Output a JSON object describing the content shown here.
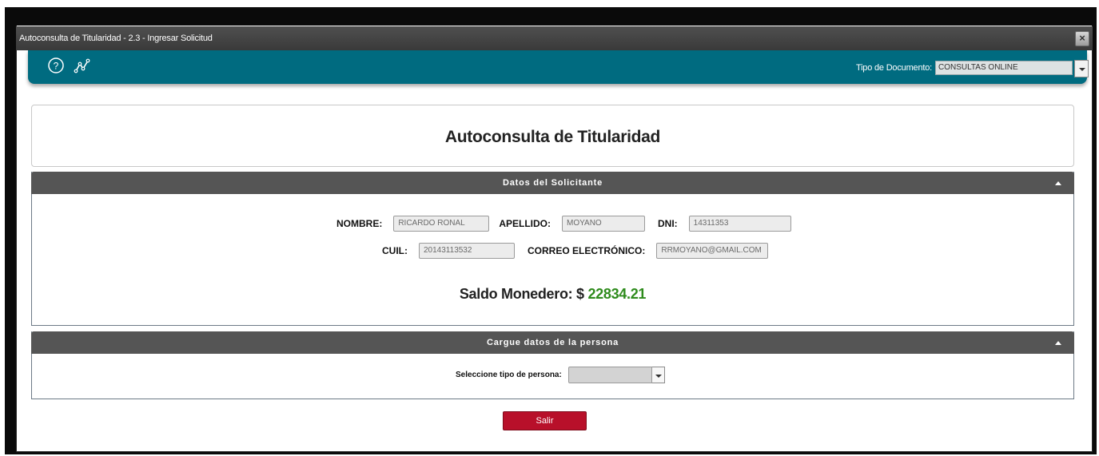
{
  "window": {
    "title": "Autoconsulta de Titularidad - 2.3 - Ingresar Solicitud",
    "close_label": "×"
  },
  "toolbar": {
    "icons": [
      "help-circle-icon",
      "chart-line-icon"
    ],
    "doc_type_label": "Tipo de Documento:",
    "doc_type_value": "CONSULTAS ONLINE"
  },
  "header": {
    "title": "Autoconsulta de Titularidad"
  },
  "solicitante": {
    "section_title": "Datos del Solicitante",
    "nombre_label": "NOMBRE:",
    "nombre_value": "RICARDO RONAL",
    "apellido_label": "APELLIDO:",
    "apellido_value": "MOYANO",
    "dni_label": "DNI:",
    "dni_value": "14311353",
    "cuil_label": "CUIL:",
    "cuil_value": "20143113532",
    "correo_label": "CORREO ELECTRÓNICO:",
    "correo_value": "RRMOYANO@GMAIL.COM",
    "saldo_label": "Saldo Monedero: $",
    "saldo_value": "22834.21"
  },
  "persona": {
    "section_title": "Cargue datos de la persona",
    "tipo_label": "Seleccione tipo de persona:",
    "tipo_value": ""
  },
  "actions": {
    "salir_label": "Salir"
  },
  "colors": {
    "toolbar": "#006b80",
    "section_header": "#555555",
    "saldo_amount": "#2e8b1c",
    "salir_button": "#b8102a"
  }
}
